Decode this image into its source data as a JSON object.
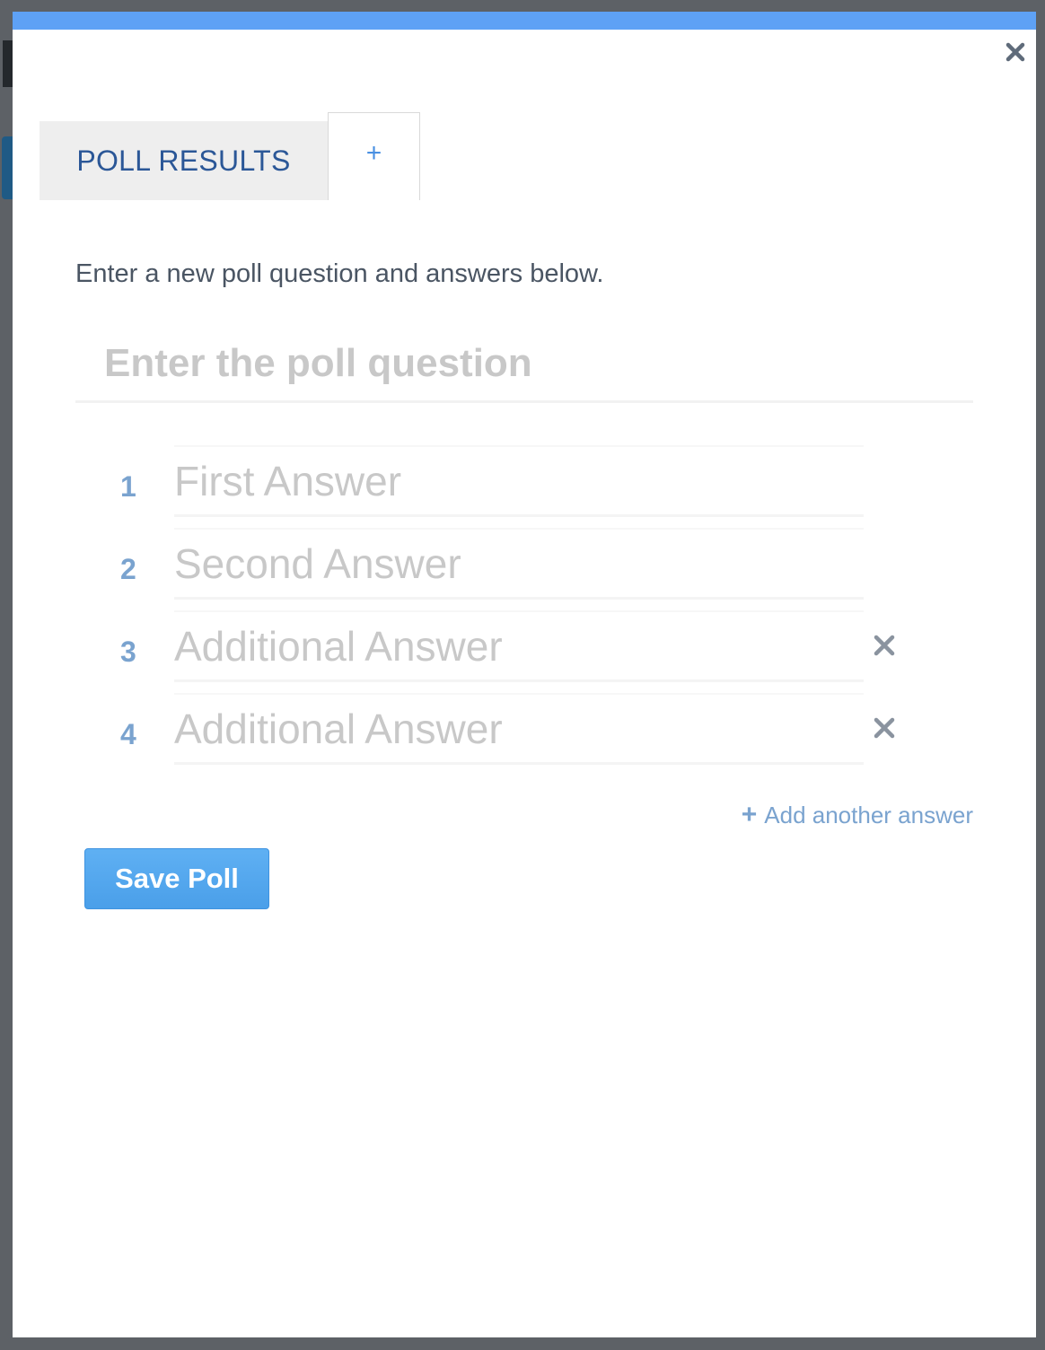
{
  "modal": {
    "close_icon": "close-icon"
  },
  "tabs": {
    "results_label": "POLL RESULTS",
    "new_label": "+"
  },
  "form": {
    "intro": "Enter a new poll question and answers below.",
    "question_placeholder": "Enter the poll question",
    "question_value": "",
    "answers": [
      {
        "number": "1",
        "placeholder": "First Answer",
        "value": "",
        "removable": false
      },
      {
        "number": "2",
        "placeholder": "Second Answer",
        "value": "",
        "removable": false
      },
      {
        "number": "3",
        "placeholder": "Additional Answer",
        "value": "",
        "removable": true
      },
      {
        "number": "4",
        "placeholder": "Additional Answer",
        "value": "",
        "removable": true
      }
    ],
    "add_answer_label": "Add another answer",
    "add_answer_icon": "plus",
    "save_label": "Save Poll"
  },
  "colors": {
    "accent_bar": "#5ea1f5",
    "tab_text": "#2b5797",
    "number_color": "#7aa3cf",
    "save_button": "#4a9fe9"
  }
}
